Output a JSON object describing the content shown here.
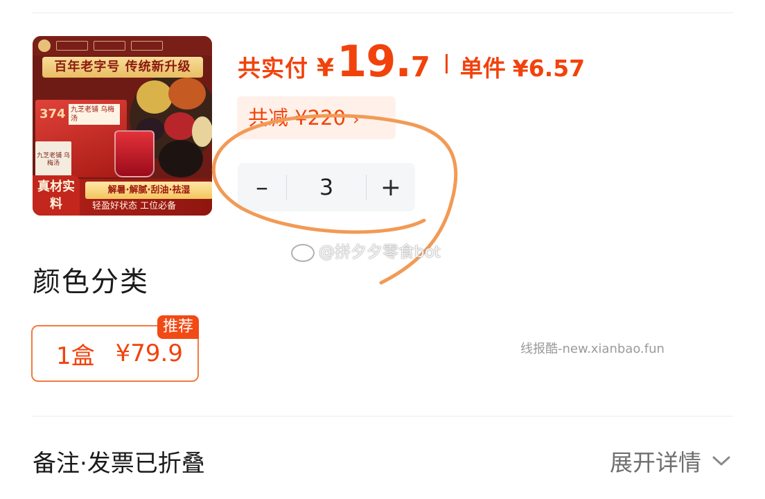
{
  "product": {
    "image_banner": "百年老字号 传统新升级",
    "image_box_number": "374",
    "image_box_name": "九芝老铺 乌梅汤",
    "image_pack_text": "九芝老铺 乌梅汤",
    "image_tag": "真材实料",
    "image_benefits": "解暑·解腻·刮油·祛湿",
    "image_subtext": "轻盈好状态 工位必备"
  },
  "pricing": {
    "total_label": "共实付",
    "currency": "¥",
    "total_int": "19.",
    "total_dec": "7",
    "unit_label": "单件",
    "unit_price": "¥6.57",
    "saving_text": "共减 ¥220",
    "saving_chevron": "›"
  },
  "stepper": {
    "minus": "–",
    "quantity": "3",
    "plus": "+"
  },
  "watermark_weibo": "@拼夕夕零食bot",
  "options": {
    "section_title": "颜色分类",
    "items": [
      {
        "quantity": "1盒",
        "price": "¥79.9",
        "badge": "推荐",
        "selected": true
      }
    ]
  },
  "watermark_site": "线报酷-new.xianbao.fun",
  "footer": {
    "collapsed_label": "备注·发票已折叠",
    "expand_label": "展开详情",
    "expand_icon": "chevron-down-icon"
  },
  "colors": {
    "accent": "#f2420c",
    "annotation": "#f29a55",
    "saving_bg": "#fff1ea",
    "stepper_bg": "#f4f6f8"
  }
}
